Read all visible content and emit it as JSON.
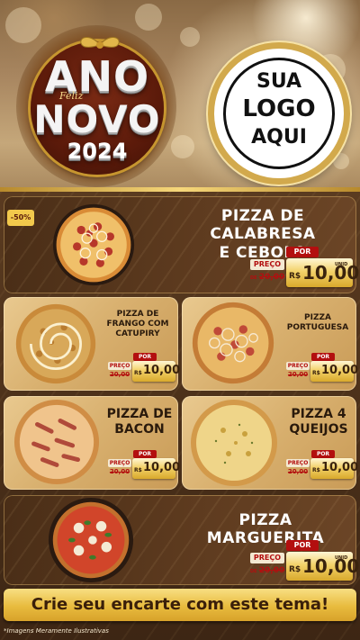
{
  "header": {
    "badge": {
      "line1": "ANO",
      "script": "Feliz",
      "line2": "NOVO",
      "year": "2024"
    },
    "logo": {
      "line1": "SUA",
      "line2": "LOGO",
      "line3": "AQUI"
    }
  },
  "discount_badge": "-50%",
  "price_labels": {
    "por": "POR",
    "preco": "PREÇO",
    "de": "DE",
    "currency": "R$",
    "unit": "UNID"
  },
  "products": [
    {
      "name_line1": "PIZZA DE CALABRESA",
      "name_line2": "E CEBOLA",
      "old_price": "20,00",
      "price": "10,00",
      "topping": "calabresa"
    },
    {
      "name_line1": "PIZZA DE",
      "name_line2": "FRANGO COM",
      "name_line3": "CATUPIRY",
      "old_price": "20,00",
      "price": "10,00",
      "topping": "frango"
    },
    {
      "name_line1": "PIZZA",
      "name_line2": "PORTUGUESA",
      "old_price": "20,00",
      "price": "10,00",
      "topping": "portuguesa"
    },
    {
      "name_line1": "PIZZA DE",
      "name_line2": "BACON",
      "old_price": "20,00",
      "price": "10,00",
      "topping": "bacon"
    },
    {
      "name_line1": "PIZZA 4",
      "name_line2": "QUEIJOS",
      "old_price": "20,00",
      "price": "10,00",
      "topping": "queijos"
    },
    {
      "name_line1": "PIZZA MARGUERITA",
      "old_price": "20,00",
      "price": "10,00",
      "topping": "marguerita"
    }
  ],
  "cta": "Crie seu encarte com este tema!",
  "footnote": "*Imagens Meramente Ilustrativas",
  "colors": {
    "gold": "#d2a94c",
    "red": "#b30f0f",
    "brown": "#3d2614",
    "card": "#d9b170"
  }
}
